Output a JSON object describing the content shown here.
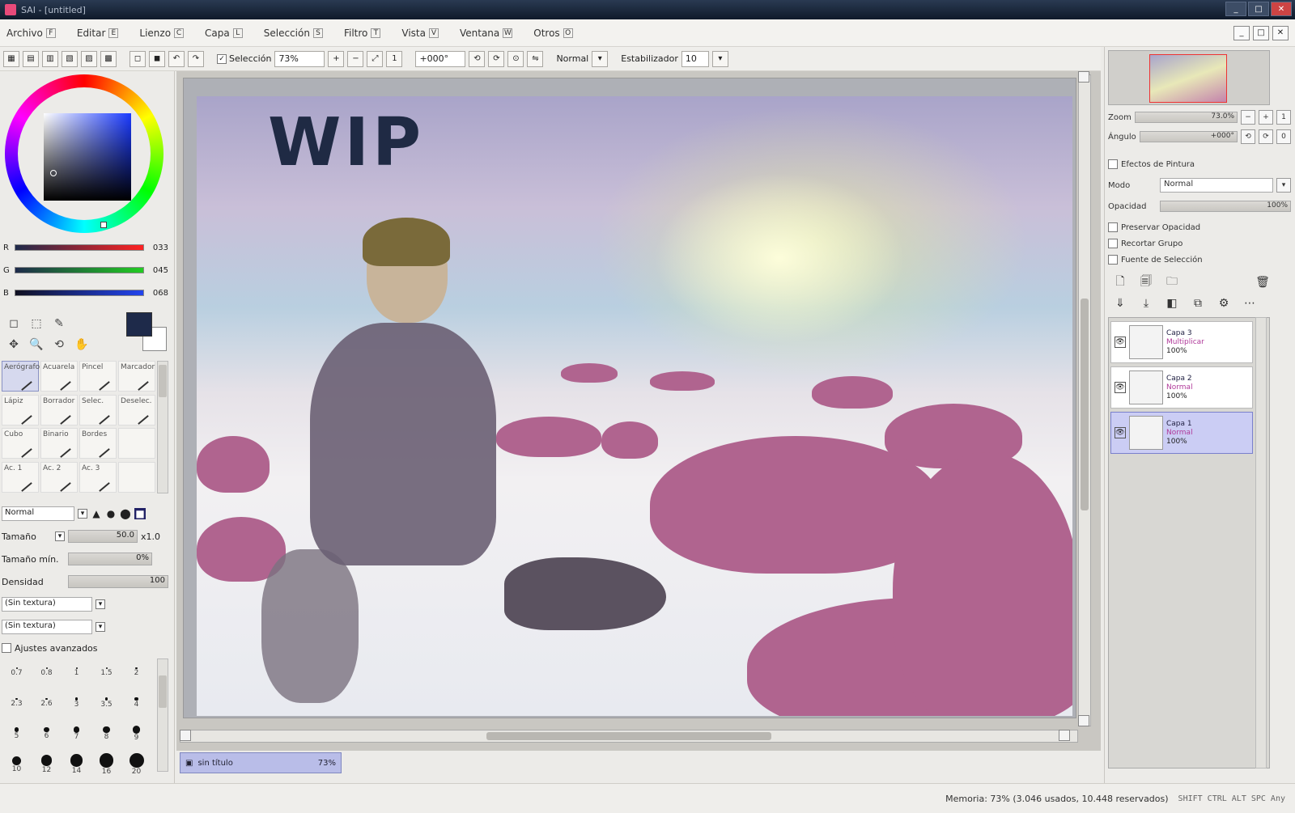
{
  "window": {
    "title": "SAI - [untitled]",
    "controls": [
      "_",
      "□",
      "✕"
    ]
  },
  "menu": {
    "items": [
      "Archivo",
      "Editar",
      "Lienzo",
      "Capa",
      "Selección",
      "Filtro",
      "Vista",
      "Ventana",
      "Otros"
    ],
    "keys": [
      "F",
      "E",
      "C",
      "L",
      "S",
      "T",
      "V",
      "W",
      "O"
    ]
  },
  "toolbar": {
    "selection_label": "Selección",
    "zoom_value": "73%",
    "rotation_value": "+000°",
    "blend_label": "Normal",
    "stabilizer_label": "Estabilizador",
    "stabilizer_value": "10"
  },
  "color": {
    "fg": "#1e2a4a",
    "rgb": [
      {
        "ch": "R",
        "val": "033",
        "color": "#e33"
      },
      {
        "ch": "G",
        "val": "045",
        "color": "#2b2"
      },
      {
        "ch": "B",
        "val": "068",
        "color": "#24e"
      }
    ]
  },
  "tools": {
    "icons": [
      "◻",
      "⬚",
      "✎",
      "✥",
      "🔍",
      "⟲",
      "✋",
      "⁄"
    ]
  },
  "brushes": [
    {
      "label": "Aerógrafo",
      "active": true
    },
    {
      "label": "Acuarela",
      "active": false
    },
    {
      "label": "Pincel",
      "active": false
    },
    {
      "label": "Marcador",
      "active": false
    },
    {
      "label": "Lápiz",
      "active": false
    },
    {
      "label": "Borrador",
      "active": false
    },
    {
      "label": "Selec.",
      "active": false
    },
    {
      "label": "Deselec.",
      "active": false
    },
    {
      "label": "Cubo",
      "active": false
    },
    {
      "label": "Binario",
      "active": false
    },
    {
      "label": "Bordes",
      "active": false
    },
    {
      "label": "",
      "active": false
    },
    {
      "label": "Ac. 1",
      "active": false
    },
    {
      "label": "Ac. 2",
      "active": false
    },
    {
      "label": "Ac. 3",
      "active": false
    },
    {
      "label": "",
      "active": false
    }
  ],
  "brush_props": {
    "mode_label": "Normal",
    "size_label": "Tamaño",
    "size_value": "50.0",
    "size_max": "x1.0",
    "min_size_label": "Tamaño mín.",
    "min_size_value": "0%",
    "density_label": "Densidad",
    "density_value": "100",
    "texture1": "(Sin textura)",
    "texture2": "(Sin textura)",
    "advanced_label": "Ajustes avanzados"
  },
  "brush_sizes": [
    "0.7",
    "0.8",
    "1",
    "1.5",
    "2",
    "2.3",
    "2.6",
    "3",
    "3.5",
    "4",
    "5",
    "6",
    "7",
    "8",
    "9",
    "10",
    "12",
    "14",
    "16",
    "20"
  ],
  "artwork": {
    "wip_text": "WIP"
  },
  "doc_tab": {
    "name": "sin título",
    "zoom": "73%"
  },
  "right": {
    "zoom_label": "Zoom",
    "zoom_value": "73.0%",
    "angle_label": "Ángulo",
    "angle_value": "+000°",
    "paint_effects_label": "Efectos de Pintura",
    "mode_label": "Modo",
    "mode_value": "Normal",
    "opacity_label": "Opacidad",
    "opacity_value": "100%",
    "preserve_opacity": "Preservar Opacidad",
    "clipping_group": "Recortar Grupo",
    "selection_source": "Fuente de Selección"
  },
  "layers": [
    {
      "name": "Capa 3",
      "mode": "Multiplicar",
      "opacity": "100%",
      "selected": false
    },
    {
      "name": "Capa 2",
      "mode": "Normal",
      "opacity": "100%",
      "selected": false
    },
    {
      "name": "Capa 1",
      "mode": "Normal",
      "opacity": "100%",
      "selected": true
    }
  ],
  "status": {
    "memory": "Memoria: 73% (3.046 usados, 10.448 reservados)",
    "keys": "SHIFT CTRL ALT SPC Any"
  }
}
